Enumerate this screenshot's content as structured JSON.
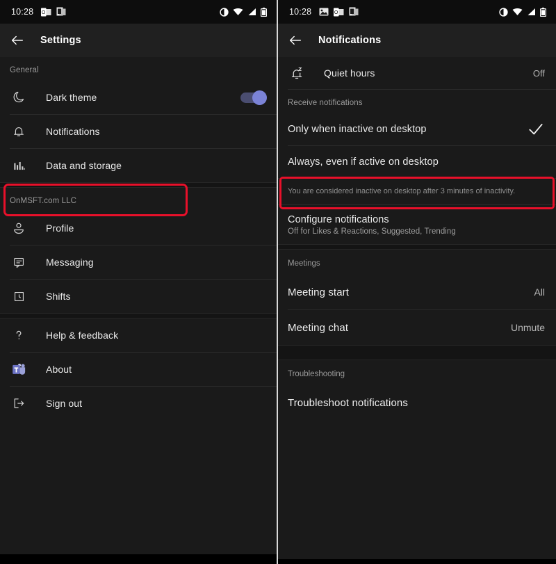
{
  "left": {
    "statusbar": {
      "time": "10:28",
      "left_icons": [
        "outlook-icon",
        "app-switcher-icon"
      ],
      "right_icons": [
        "dnd-icon",
        "wifi-icon",
        "signal-icon",
        "battery-icon"
      ]
    },
    "appbar": {
      "back": "back-arrow",
      "title": "Settings"
    },
    "sections": [
      {
        "header": "General",
        "items": [
          {
            "icon": "moon-icon",
            "label": "Dark theme",
            "control": "toggle",
            "toggle_on": true
          },
          {
            "icon": "bell-icon",
            "label": "Notifications",
            "highlighted": true
          },
          {
            "icon": "chart-bars-icon",
            "label": "Data and storage"
          }
        ]
      },
      {
        "header": "OnMSFT.com LLC",
        "items": [
          {
            "icon": "person-icon",
            "label": "Profile"
          },
          {
            "icon": "message-icon",
            "label": "Messaging"
          },
          {
            "icon": "clock-icon",
            "label": "Shifts"
          }
        ]
      },
      {
        "header": "",
        "items": [
          {
            "icon": "question-icon",
            "label": "Help & feedback"
          },
          {
            "icon": "teams-logo-icon",
            "label": "About"
          },
          {
            "icon": "sign-out-icon",
            "label": "Sign out"
          }
        ]
      }
    ]
  },
  "right": {
    "statusbar": {
      "time": "10:28",
      "left_icons": [
        "image-icon",
        "outlook-icon",
        "app-switcher-icon"
      ],
      "right_icons": [
        "dnd-icon",
        "wifi-icon",
        "signal-icon",
        "battery-icon"
      ]
    },
    "appbar": {
      "back": "back-arrow",
      "title": "Notifications"
    },
    "quiet_hours": {
      "icon": "bell-z-icon",
      "label": "Quiet hours",
      "value": "Off"
    },
    "receive_header": "Receive notifications",
    "options": [
      {
        "label": "Only when inactive on desktop",
        "selected": true,
        "highlighted": true
      },
      {
        "label": "Always, even if active on desktop",
        "selected": false
      }
    ],
    "helper_text": "You are considered inactive on desktop after 3 minutes of inactivity.",
    "configure": {
      "label": "Configure notifications",
      "sub": "Off for Likes & Reactions, Suggested, Trending"
    },
    "meetings_header": "Meetings",
    "meetings": [
      {
        "label": "Meeting start",
        "value": "All"
      },
      {
        "label": "Meeting chat",
        "value": "Unmute"
      }
    ],
    "troubleshooting_header": "Troubleshooting",
    "troubleshoot": {
      "label": "Troubleshoot notifications"
    }
  },
  "colors": {
    "accent_toggle": "#7b83d6",
    "highlight_border": "#e8102a",
    "background": "#1a1a1a",
    "appbar": "#202020"
  }
}
